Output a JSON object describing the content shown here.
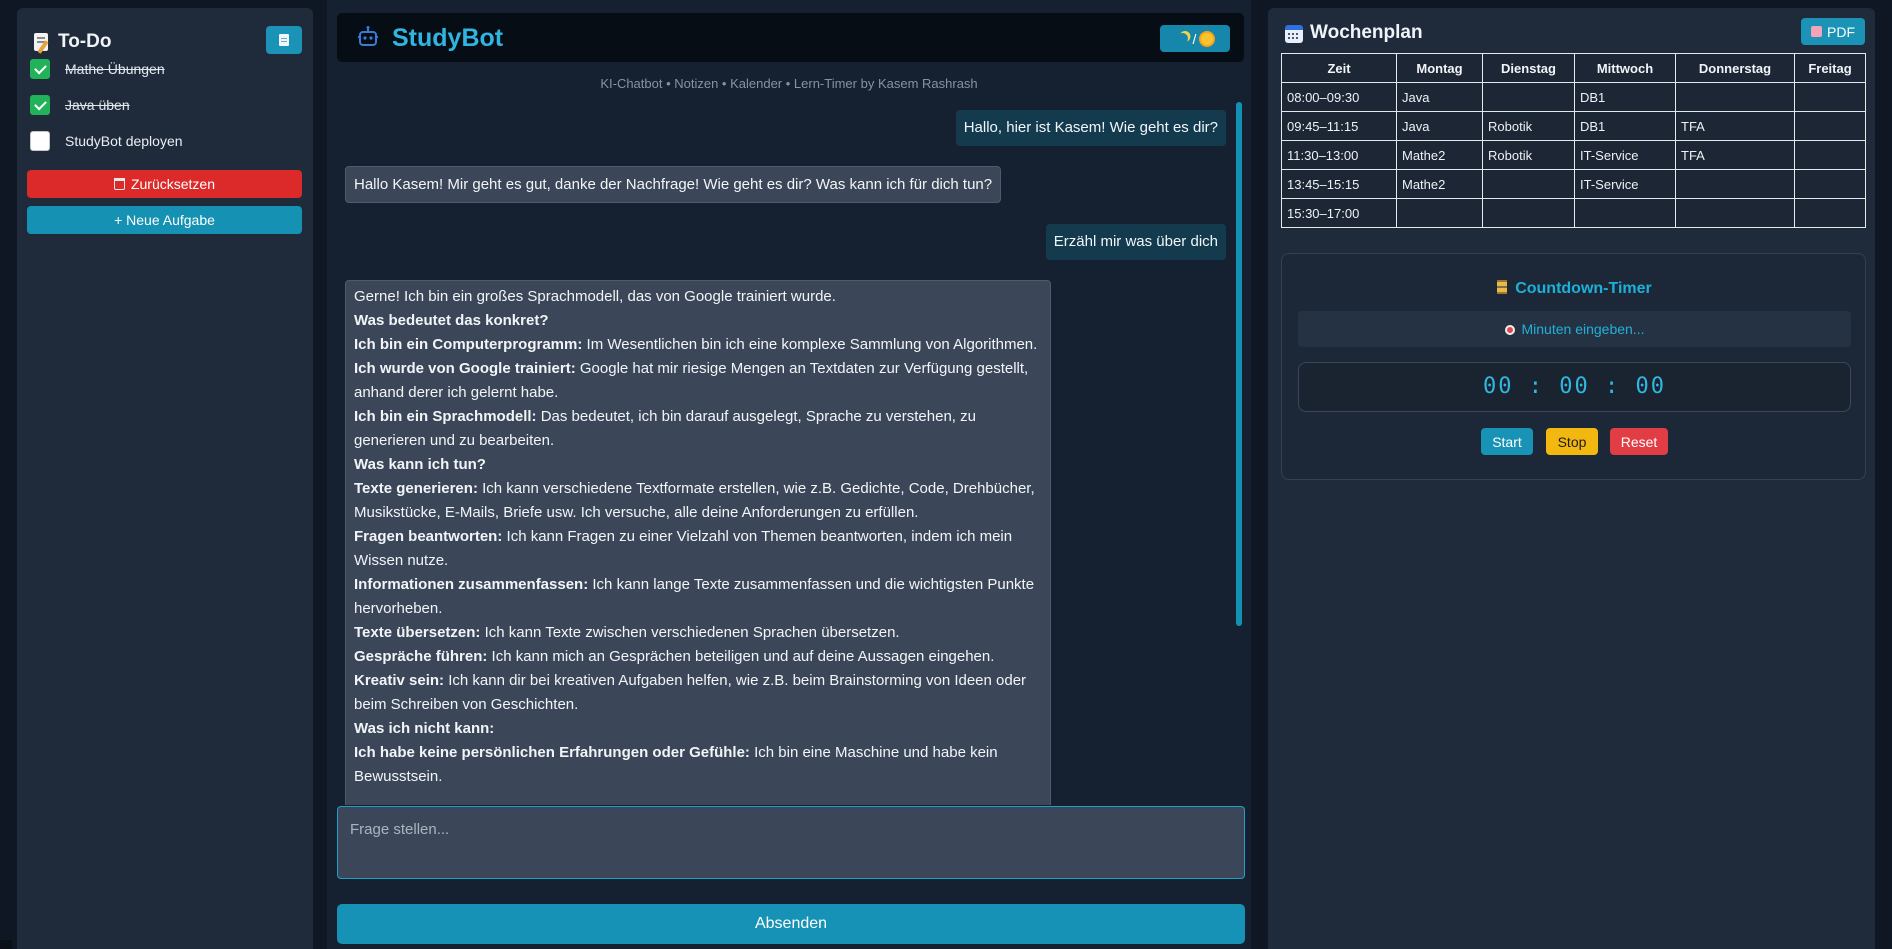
{
  "todo": {
    "title": "To-Do",
    "items": [
      {
        "label": "Mathe Übungen",
        "done": true
      },
      {
        "label": "Java üben",
        "done": true
      },
      {
        "label": "StudyBot deployen",
        "done": false
      }
    ],
    "reset_label": "Zurücksetzen",
    "add_label": "+ Neue Aufgabe"
  },
  "header": {
    "brand": "StudyBot",
    "theme_toggle_sep": "/",
    "subtitle": "KI-Chatbot • Notizen • Kalender • Lern-Timer by Kasem Rashrash"
  },
  "chat": {
    "messages": [
      {
        "role": "user",
        "text": "Hallo, hier ist Kasem! Wie geht es dir?"
      },
      {
        "role": "bot",
        "text": "Hallo Kasem! Mir geht es gut, danke der Nachfrage! Wie geht es dir? Was kann ich für dich tun?"
      },
      {
        "role": "user",
        "text": "Erzähl mir was über dich"
      },
      {
        "role": "bot",
        "lines": [
          {
            "bold": "",
            "text": "Gerne! Ich bin ein großes Sprachmodell, das von Google trainiert wurde."
          },
          {
            "bold": "Was bedeutet das konkret?",
            "text": ""
          },
          {
            "bold": "Ich bin ein Computerprogramm:",
            "text": " Im Wesentlichen bin ich eine komplexe Sammlung von Algorithmen."
          },
          {
            "bold": "Ich wurde von Google trainiert:",
            "text": " Google hat mir riesige Mengen an Textdaten zur Verfügung gestellt, anhand derer ich gelernt habe."
          },
          {
            "bold": "Ich bin ein Sprachmodell:",
            "text": " Das bedeutet, ich bin darauf ausgelegt, Sprache zu verstehen, zu generieren und zu bearbeiten."
          },
          {
            "bold": "Was kann ich tun?",
            "text": ""
          },
          {
            "bold": "Texte generieren:",
            "text": " Ich kann verschiedene Textformate erstellen, wie z.B. Gedichte, Code, Drehbücher, Musikstücke, E-Mails, Briefe usw. Ich versuche, alle deine Anforderungen zu erfüllen."
          },
          {
            "bold": "Fragen beantworten:",
            "text": " Ich kann Fragen zu einer Vielzahl von Themen beantworten, indem ich mein Wissen nutze."
          },
          {
            "bold": "Informationen zusammenfassen:",
            "text": " Ich kann lange Texte zusammenfassen und die wichtigsten Punkte hervorheben."
          },
          {
            "bold": "Texte übersetzen:",
            "text": " Ich kann Texte zwischen verschiedenen Sprachen übersetzen."
          },
          {
            "bold": "Gespräche führen:",
            "text": " Ich kann mich an Gesprächen beteiligen und auf deine Aussagen eingehen."
          },
          {
            "bold": "Kreativ sein:",
            "text": " Ich kann dir bei kreativen Aufgaben helfen, wie z.B. beim Brainstorming von Ideen oder beim Schreiben von Geschichten."
          },
          {
            "bold": "Was ich nicht kann:",
            "text": ""
          },
          {
            "bold": "Ich habe keine persönlichen Erfahrungen oder Gefühle:",
            "text": " Ich bin eine Maschine und habe kein Bewusstsein."
          }
        ]
      }
    ],
    "input_placeholder": "Frage stellen...",
    "send_label": "Absenden"
  },
  "plan": {
    "title": "Wochenplan",
    "pdf_label": "PDF",
    "columns": [
      "Zeit",
      "Montag",
      "Dienstag",
      "Mittwoch",
      "Donnerstag",
      "Freitag"
    ],
    "rows": [
      [
        "08:00–09:30",
        "Java",
        "",
        "DB1",
        "",
        ""
      ],
      [
        "09:45–11:15",
        "Java",
        "Robotik",
        "DB1",
        "TFA",
        ""
      ],
      [
        "11:30–13:00",
        "Mathe2",
        "Robotik",
        "IT-Service",
        "TFA",
        ""
      ],
      [
        "13:45–15:15",
        "Mathe2",
        "",
        "IT-Service",
        "",
        ""
      ],
      [
        "15:30–17:00",
        "",
        "",
        "",
        "",
        ""
      ]
    ]
  },
  "timer": {
    "title": "Countdown-Timer",
    "minutes_placeholder": "Minuten eingeben...",
    "display": "00 : 00 : 00",
    "start_label": "Start",
    "stop_label": "Stop",
    "reset_label": "Reset"
  },
  "colors": {
    "accent": "#1592b5",
    "danger": "#dc2a2a",
    "warning": "#f3b80f",
    "success": "#21b25a"
  }
}
